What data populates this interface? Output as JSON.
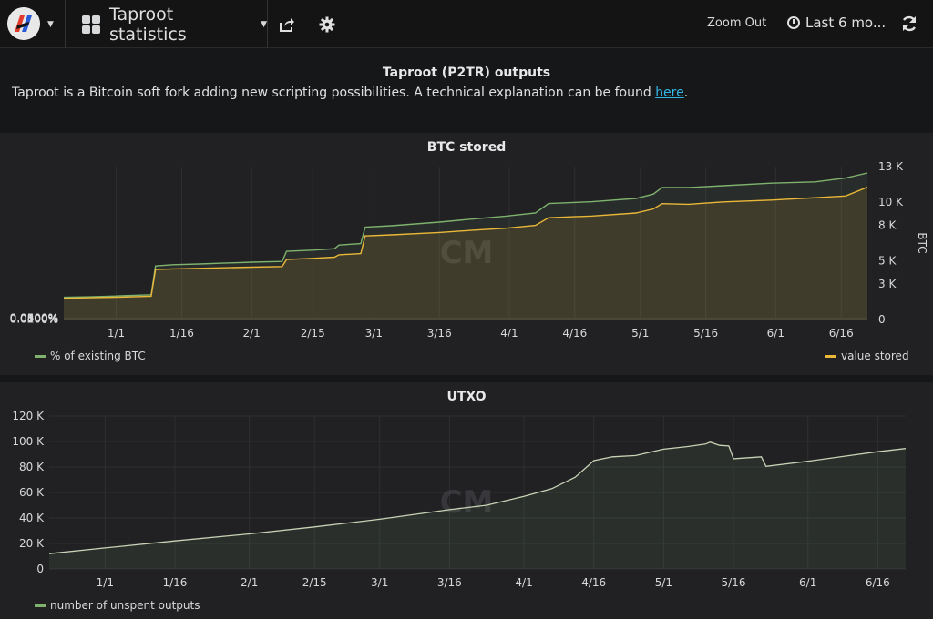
{
  "app": {
    "dashboard_title": "Taproot statistics",
    "zoom_out_label": "Zoom Out",
    "time_range_label": "Last 6 mo..."
  },
  "icons": {
    "logo": "app-logo-icon",
    "dashboard": "dashboard-grid-icon",
    "share": "share-icon",
    "settings": "gear-icon",
    "time": "clock-icon",
    "refresh": "refresh-icon"
  },
  "intro": {
    "title": "Taproot (P2TR) outputs",
    "text_before": "Taproot is a Bitcoin soft fork adding new scripting possibilities. A technical explanation can be found ",
    "link_text": "here",
    "text_after": "."
  },
  "watermark_text": "CM",
  "chart_data": [
    {
      "type": "line",
      "title": "BTC stored",
      "x_ticks": [
        "1/1",
        "1/16",
        "2/1",
        "2/15",
        "3/1",
        "3/16",
        "4/1",
        "4/16",
        "5/1",
        "5/16",
        "6/1",
        "6/16"
      ],
      "x_range": [
        "12/20",
        "6/22"
      ],
      "y_left_ticks": [
        "0%",
        "0.0100%",
        "0.0200%",
        "0.0300%",
        "0.0400%",
        "0.0500%",
        "0.0600%"
      ],
      "y_left_range": [
        0,
        0.06
      ],
      "y_right_ticks": [
        "0",
        "3 K",
        "5 K",
        "8 K",
        "10 K",
        "13 K"
      ],
      "y_right_range": [
        0,
        13000
      ],
      "y_right_label": "BTC",
      "grid": true,
      "legend_placement": "bottom",
      "series": [
        {
          "name": "% of existing BTC",
          "axis": "left",
          "color": "#7eb26d",
          "points": [
            [
              "12/20",
              0.0087
            ],
            [
              "12/26",
              0.0089
            ],
            [
              "1/2",
              0.0093
            ],
            [
              "1/9",
              0.0097
            ],
            [
              "1/10",
              0.021
            ],
            [
              "1/14",
              0.0215
            ],
            [
              "1/20",
              0.0218
            ],
            [
              "2/1",
              0.0225
            ],
            [
              "2/8",
              0.0228
            ],
            [
              "2/9",
              0.0268
            ],
            [
              "2/15",
              0.0272
            ],
            [
              "2/20",
              0.0278
            ],
            [
              "2/21",
              0.0292
            ],
            [
              "2/26",
              0.0298
            ],
            [
              "2/27",
              0.0362
            ],
            [
              "3/5",
              0.0368
            ],
            [
              "3/16",
              0.0382
            ],
            [
              "3/24",
              0.0395
            ],
            [
              "3/31",
              0.0405
            ],
            [
              "4/7",
              0.0418
            ],
            [
              "4/10",
              0.0455
            ],
            [
              "4/20",
              0.0462
            ],
            [
              "4/30",
              0.0475
            ],
            [
              "5/4",
              0.0492
            ],
            [
              "5/6",
              0.0518
            ],
            [
              "5/12",
              0.0518
            ],
            [
              "5/20",
              0.0525
            ],
            [
              "5/31",
              0.0535
            ],
            [
              "6/10",
              0.054
            ],
            [
              "6/17",
              0.0555
            ],
            [
              "6/22",
              0.0575
            ]
          ]
        },
        {
          "name": "value stored",
          "axis": "right",
          "color": "#eab839",
          "points": [
            [
              "12/20",
              1800
            ],
            [
              "12/26",
              1850
            ],
            [
              "1/2",
              1900
            ],
            [
              "1/9",
              1980
            ],
            [
              "1/10",
              4250
            ],
            [
              "1/14",
              4300
            ],
            [
              "1/20",
              4350
            ],
            [
              "2/1",
              4450
            ],
            [
              "2/8",
              4500
            ],
            [
              "2/9",
              5100
            ],
            [
              "2/15",
              5200
            ],
            [
              "2/20",
              5300
            ],
            [
              "2/21",
              5500
            ],
            [
              "2/26",
              5600
            ],
            [
              "2/27",
              7100
            ],
            [
              "3/5",
              7200
            ],
            [
              "3/16",
              7400
            ],
            [
              "3/24",
              7600
            ],
            [
              "3/31",
              7750
            ],
            [
              "4/7",
              8000
            ],
            [
              "4/10",
              8650
            ],
            [
              "4/20",
              8800
            ],
            [
              "4/30",
              9050
            ],
            [
              "5/4",
              9400
            ],
            [
              "5/6",
              9850
            ],
            [
              "5/12",
              9800
            ],
            [
              "5/20",
              10000
            ],
            [
              "5/31",
              10150
            ],
            [
              "6/10",
              10350
            ],
            [
              "6/17",
              10500
            ],
            [
              "6/22",
              11250
            ]
          ]
        }
      ]
    },
    {
      "type": "area",
      "title": "UTXO",
      "x_ticks": [
        "1/1",
        "1/16",
        "2/1",
        "2/15",
        "3/1",
        "3/16",
        "4/1",
        "4/16",
        "5/1",
        "5/16",
        "6/1",
        "6/16"
      ],
      "x_range": [
        "12/20",
        "6/22"
      ],
      "y_ticks": [
        "0",
        "20 K",
        "40 K",
        "60 K",
        "80 K",
        "100 K",
        "120 K"
      ],
      "y_range": [
        0,
        120000
      ],
      "grid": true,
      "legend_placement": "bottom-left",
      "series": [
        {
          "name": "number of unspent outputs",
          "color": "#7eb26d",
          "points": [
            [
              "12/20",
              12000
            ],
            [
              "1/1",
              16500
            ],
            [
              "1/16",
              22000
            ],
            [
              "2/1",
              27500
            ],
            [
              "2/15",
              33000
            ],
            [
              "3/1",
              39000
            ],
            [
              "3/16",
              46500
            ],
            [
              "3/24",
              50000
            ],
            [
              "4/1",
              57000
            ],
            [
              "4/7",
              63000
            ],
            [
              "4/12",
              72000
            ],
            [
              "4/16",
              85000
            ],
            [
              "4/20",
              88000
            ],
            [
              "4/25",
              89000
            ],
            [
              "5/1",
              94000
            ],
            [
              "5/6",
              96000
            ],
            [
              "5/10",
              98000
            ],
            [
              "5/11",
              99500
            ],
            [
              "5/13",
              97000
            ],
            [
              "5/15",
              96500
            ],
            [
              "5/16",
              86500
            ],
            [
              "5/22",
              88000
            ],
            [
              "5/23",
              80500
            ],
            [
              "6/1",
              84500
            ],
            [
              "6/10",
              89000
            ],
            [
              "6/16",
              92000
            ],
            [
              "6/22",
              94500
            ]
          ]
        }
      ]
    }
  ]
}
